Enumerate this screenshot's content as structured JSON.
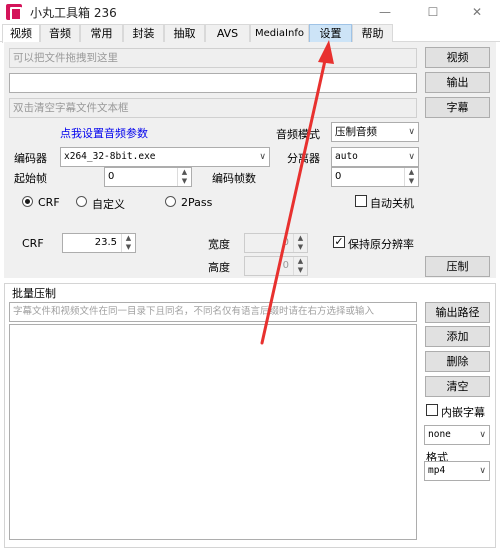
{
  "window": {
    "title": "小丸工具箱 236",
    "minimize": "—",
    "maximize": "☐",
    "close": "✕"
  },
  "tabs": [
    {
      "label": "视频"
    },
    {
      "label": "音频"
    },
    {
      "label": "常用"
    },
    {
      "label": "封装"
    },
    {
      "label": "抽取"
    },
    {
      "label": "AVS"
    },
    {
      "label": "MediaInfo"
    },
    {
      "label": "设置"
    },
    {
      "label": "帮助"
    }
  ],
  "video": {
    "file_drop_placeholder": "可以把文件拖拽到这里",
    "output_field_value": "",
    "subtitle_placeholder": "双击清空字幕文件文本框",
    "video_button": "视频",
    "output_button": "输出",
    "subtitle_button": "字幕",
    "audio_settings_link": "点我设置音频参数",
    "audio_mode_label": "音频模式",
    "audio_mode_value": "压制音频",
    "encoder_label": "编码器",
    "encoder_value": "x264_32-8bit.exe",
    "splitter_label": "分离器",
    "splitter_value": "auto",
    "start_frame_label": "起始帧",
    "start_frame_value": "0",
    "encode_frames_label": "编码帧数",
    "encode_frames_value": "0",
    "mode_crf": "CRF",
    "mode_custom": "自定义",
    "mode_2pass": "2Pass",
    "auto_shutdown": "自动关机",
    "crf_label": "CRF",
    "crf_value": "23.5",
    "width_label": "宽度",
    "width_value": "0",
    "height_label": "高度",
    "height_value": "0",
    "keep_resolution": "保持原分辨率",
    "compress_button": "压制"
  },
  "batch": {
    "title": "批量压制",
    "hint": "字幕文件和视频文件在同一目录下且同名，不同名仅有语言后缀时请在右方选择或输入",
    "output_path_button": "输出路径",
    "add_button": "添加",
    "delete_button": "删除",
    "clear_button": "清空",
    "embed_subtitle": "内嵌字幕",
    "subtitle_lang_value": "none",
    "format_label": "格式",
    "format_value": "mp4"
  },
  "colors": {
    "annotation_arrow": "#e8312f",
    "highlight_tab": "#cde4f7",
    "link": "#0000ee"
  }
}
